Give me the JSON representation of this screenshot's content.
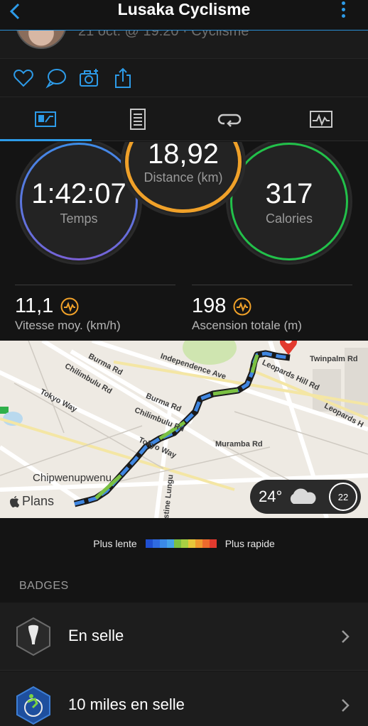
{
  "header": {
    "title": "Lusaka Cyclisme"
  },
  "profile": {
    "subline": "21 oct. @ 19:20 · Cyclisme"
  },
  "actions": [
    "heart-icon",
    "comment-icon",
    "add-photo-icon",
    "share-icon"
  ],
  "tabs": [
    "stats-tab",
    "details-tab",
    "laps-tab",
    "chart-tab"
  ],
  "stats": {
    "time": {
      "value": "1:42:07",
      "label": "Temps"
    },
    "distance": {
      "value": "18,92",
      "label": "Distance (km)"
    },
    "calories": {
      "value": "317",
      "label": "Calories"
    },
    "avg_speed": {
      "value": "11,1",
      "label": "Vitesse moy. (km/h)"
    },
    "ascent": {
      "value": "198",
      "label": "Ascension totale (m)"
    }
  },
  "map": {
    "labels": {
      "burma1": "Burma Rd",
      "independence": "Independence Ave",
      "leopards": "Leopards Hill Rd",
      "twinpalm": "Twinpalm Rd",
      "leopards2": "Leopards H",
      "chilimbulu1": "Chilimbulu Rd",
      "burma2": "Burma Rd",
      "chilimbulu2": "Chilimbulu Rd",
      "tokyo1": "Tokyo Way",
      "tokyo2": "Tokyo Way",
      "muramba": "Muramba Rd",
      "chipwenupwenu": "Chipwenupwenu",
      "lungu": "stine Lungu"
    },
    "attribution": "Plans",
    "weather": {
      "temperature": "24°",
      "wind": "22"
    }
  },
  "legend": {
    "slow": "Plus lente",
    "fast": "Plus rapide",
    "colors": [
      "#1f4fd1",
      "#2f6be0",
      "#3a8ae8",
      "#45a3e8",
      "#7bc142",
      "#a8d043",
      "#e8c73a",
      "#f09a2e",
      "#ee6a2c",
      "#e23a2e"
    ]
  },
  "badges": {
    "header": "BADGES",
    "items": [
      {
        "name": "En selle"
      },
      {
        "name": "10 miles en selle"
      }
    ]
  },
  "colors": {
    "accent": "#2d9be8",
    "time_ring": "#5b7be0",
    "distance_ring": "#f0a129",
    "calories_ring": "#22c14a"
  }
}
